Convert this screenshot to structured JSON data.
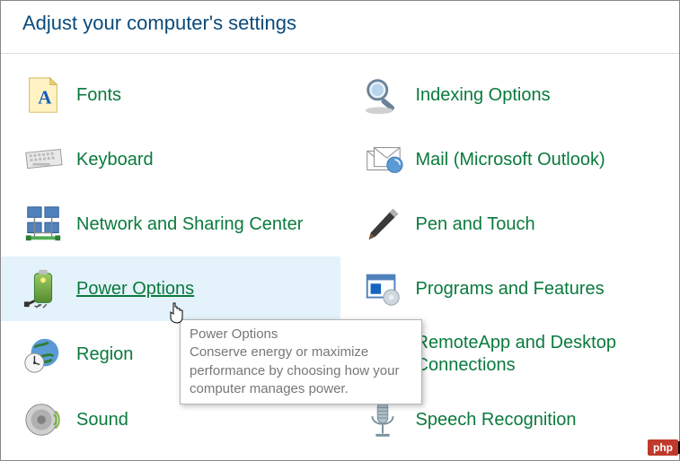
{
  "header": {
    "title": "Adjust your computer's settings"
  },
  "items": {
    "left": [
      {
        "id": "fonts",
        "label": "Fonts",
        "icon": "fonts"
      },
      {
        "id": "keyboard",
        "label": "Keyboard",
        "icon": "keyboard"
      },
      {
        "id": "network",
        "label": "Network and Sharing Center",
        "icon": "network"
      },
      {
        "id": "power",
        "label": "Power Options",
        "icon": "power",
        "hover": true
      },
      {
        "id": "region",
        "label": "Region",
        "icon": "region"
      },
      {
        "id": "sound",
        "label": "Sound",
        "icon": "sound"
      }
    ],
    "right": [
      {
        "id": "indexing",
        "label": "Indexing Options",
        "icon": "indexing"
      },
      {
        "id": "mail",
        "label": "Mail (Microsoft Outlook)",
        "icon": "mail"
      },
      {
        "id": "pen",
        "label": "Pen and Touch",
        "icon": "pen"
      },
      {
        "id": "programs",
        "label": "Programs and Features",
        "icon": "programs"
      },
      {
        "id": "remoteapp",
        "label": "RemoteApp and Desktop Connections",
        "icon": "remoteapp"
      },
      {
        "id": "speech",
        "label": "Speech Recognition",
        "icon": "speech"
      }
    ]
  },
  "tooltip": {
    "title": "Power Options",
    "body": "Conserve energy or maximize performance by choosing how your computer manages power."
  },
  "watermark": "php"
}
